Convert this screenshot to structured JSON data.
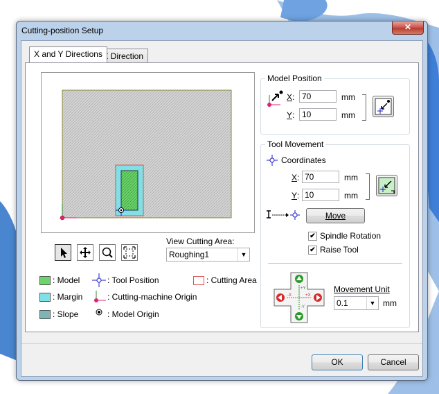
{
  "window": {
    "title": "Cutting-position Setup",
    "close_glyph": "✕"
  },
  "tabs": [
    {
      "label": "X and Y Directions",
      "active": true
    },
    {
      "label": "Z Direction",
      "active": false
    }
  ],
  "model_position": {
    "title": "Model Position",
    "x_label": "X",
    "x_value": "70",
    "y_label": "Y",
    "y_value": "10",
    "unit": "mm"
  },
  "tool_movement": {
    "title": "Tool Movement",
    "coordinates_label": "Coordinates",
    "x_label": "X",
    "x_value": "70",
    "y_label": "Y",
    "y_value": "10",
    "unit": "mm",
    "move_button": "Move",
    "spindle_rotation": {
      "label": "Spindle Rotation",
      "checked": true
    },
    "raise_tool": {
      "label": "Raise Tool",
      "checked": true
    },
    "movement_unit_label": "Movement Unit",
    "movement_unit_value": "0.1",
    "movement_unit_suffix": "mm"
  },
  "view_cutting_area": {
    "label": "View Cutting Area:",
    "selected": "Roughing1"
  },
  "legend": {
    "model": ": Model",
    "margin": ": Margin",
    "slope": ": Slope",
    "tool_position": ": Tool Position",
    "cutting_origin": ": Cutting-machine Origin",
    "model_origin": ": Model Origin",
    "cutting_area": ": Cutting Area"
  },
  "jog_pad": {
    "plus_y": "+Y",
    "minus_y": "-Y",
    "minus_x": "-X",
    "plus_x": "+X"
  },
  "buttons": {
    "ok": "OK",
    "cancel": "Cancel"
  },
  "colors": {
    "model": "#6cd46c",
    "margin": "#7fe0e6",
    "slope": "#7fb5b5",
    "cutting_area": "#e05050",
    "tool_position": "#1a1acc",
    "origin": "#e0207a",
    "area_fill": "#d0d0d0"
  }
}
